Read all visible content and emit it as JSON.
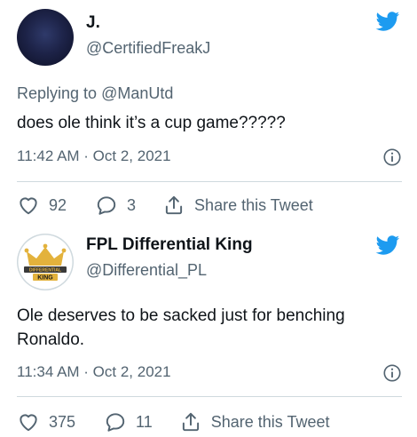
{
  "tweets": [
    {
      "author_name": "J.",
      "author_handle": "@CertifiedFreakJ",
      "reply_prefix": "Replying to",
      "reply_to": "@ManUtd",
      "text": "does ole think it’s a cup game?????",
      "timestamp": "11:42 AM · Oct 2, 2021",
      "likes": "92",
      "replies": "3",
      "share_label": "Share this Tweet"
    },
    {
      "author_name": "FPL Differential King",
      "author_handle": "@Differential_PL",
      "avatar_text_top": "DIFFERENTIAL",
      "avatar_text_bottom": "KING",
      "text": "Ole deserves to be sacked just for benching Ronaldo.",
      "timestamp": "11:34 AM · Oct 2, 2021",
      "likes": "375",
      "replies": "11",
      "share_label": "Share this Tweet"
    }
  ],
  "colors": {
    "twitter_blue": "#1d9bf0",
    "text_primary": "#0f1419",
    "text_secondary": "#536471",
    "divider": "#cfd9de",
    "crown_gold": "#e3b23c"
  },
  "icons": {
    "brand": "twitter-bird-icon",
    "info": "info-icon",
    "like": "heart-icon",
    "reply": "reply-bubble-icon",
    "share": "share-icon"
  }
}
